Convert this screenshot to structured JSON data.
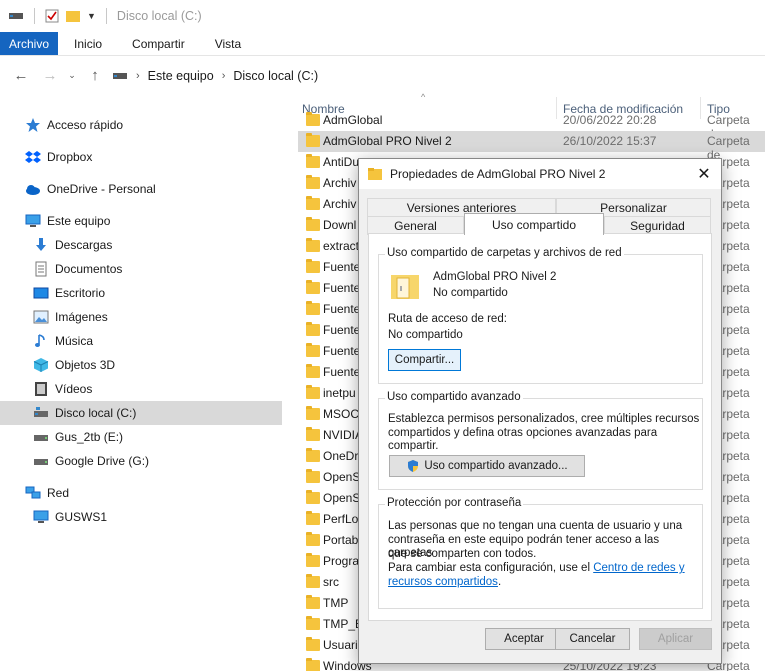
{
  "window": {
    "title": "Disco local (C:)"
  },
  "ribbon": {
    "tabs": [
      "Archivo",
      "Inicio",
      "Compartir",
      "Vista"
    ]
  },
  "address": {
    "segments": [
      "Este equipo",
      "Disco local (C:)"
    ]
  },
  "sidebar": {
    "items": [
      {
        "label": "Acceso rápido",
        "icon": "star-icon"
      },
      {
        "label": "Dropbox",
        "icon": "dropbox-icon"
      },
      {
        "label": "OneDrive - Personal",
        "icon": "cloud-icon"
      },
      {
        "label": "Este equipo",
        "icon": "computer-icon"
      },
      {
        "label": "Descargas",
        "icon": "download-icon"
      },
      {
        "label": "Documentos",
        "icon": "document-icon"
      },
      {
        "label": "Escritorio",
        "icon": "desktop-icon"
      },
      {
        "label": "Imágenes",
        "icon": "image-icon"
      },
      {
        "label": "Música",
        "icon": "music-icon"
      },
      {
        "label": "Objetos 3D",
        "icon": "cube-icon"
      },
      {
        "label": "Vídeos",
        "icon": "video-icon"
      },
      {
        "label": "Disco local (C:)",
        "icon": "drive-icon"
      },
      {
        "label": "Gus_2tb (E:)",
        "icon": "drive-icon"
      },
      {
        "label": "Google Drive (G:)",
        "icon": "drive-icon"
      },
      {
        "label": "Red",
        "icon": "network-icon"
      },
      {
        "label": "GUSWS1",
        "icon": "computer-icon"
      }
    ]
  },
  "columns": {
    "name": "Nombre",
    "date": "Fecha de modificación",
    "type": "Tipo"
  },
  "files": [
    {
      "name": "AdmGlobal",
      "date": "20/06/2022 20:28",
      "type": "Carpeta de"
    },
    {
      "name": "AdmGlobal PRO Nivel 2",
      "date": "26/10/2022 15:37",
      "type": "Carpeta de"
    },
    {
      "name": "AntiDu",
      "date": "",
      "type": "Carpeta de"
    },
    {
      "name": "Archiv",
      "date": "",
      "type": "Carpeta de"
    },
    {
      "name": "Archiv",
      "date": "",
      "type": "Carpeta de"
    },
    {
      "name": "Downl",
      "date": "",
      "type": "Carpeta de"
    },
    {
      "name": "extract",
      "date": "",
      "type": "Carpeta de"
    },
    {
      "name": "Fuente",
      "date": "",
      "type": "Carpeta de"
    },
    {
      "name": "Fuente",
      "date": "",
      "type": "Carpeta de"
    },
    {
      "name": "Fuente",
      "date": "",
      "type": "Carpeta de"
    },
    {
      "name": "Fuente",
      "date": "",
      "type": "Carpeta de"
    },
    {
      "name": "Fuente",
      "date": "",
      "type": "Carpeta de"
    },
    {
      "name": "Fuente",
      "date": "",
      "type": "Carpeta de"
    },
    {
      "name": "inetpu",
      "date": "",
      "type": "Carpeta de"
    },
    {
      "name": "MSOC",
      "date": "",
      "type": "Carpeta de"
    },
    {
      "name": "NVIDIA",
      "date": "",
      "type": "Carpeta de"
    },
    {
      "name": "OneDr",
      "date": "",
      "type": "Carpeta de"
    },
    {
      "name": "OpenS",
      "date": "",
      "type": "Carpeta de"
    },
    {
      "name": "OpenS",
      "date": "",
      "type": "Carpeta de"
    },
    {
      "name": "PerfLo",
      "date": "",
      "type": "Carpeta de"
    },
    {
      "name": "Portab",
      "date": "",
      "type": "Carpeta de"
    },
    {
      "name": "Progra",
      "date": "",
      "type": "Carpeta de"
    },
    {
      "name": "src",
      "date": "",
      "type": "Carpeta de"
    },
    {
      "name": "TMP",
      "date": "",
      "type": "Carpeta de"
    },
    {
      "name": "TMP_E",
      "date": "",
      "type": "Carpeta de"
    },
    {
      "name": "Usuari",
      "date": "",
      "type": "Carpeta de"
    },
    {
      "name": "Windows",
      "date": "25/10/2022 19:23",
      "type": "Carpeta de"
    }
  ],
  "dialog": {
    "title": "Propiedades de AdmGlobal PRO Nivel 2",
    "tabs_back": [
      "Versiones anteriores",
      "Personalizar"
    ],
    "tabs_front": [
      "General",
      "Uso compartido",
      "Seguridad"
    ],
    "network_group": {
      "label": "Uso compartido de carpetas y archivos de red",
      "folder_name": "AdmGlobal PRO Nivel 2",
      "status": "No compartido",
      "path_label": "Ruta de acceso de red:",
      "path_value": "No compartido",
      "share_button": "Compartir..."
    },
    "advanced_group": {
      "label": "Uso compartido avanzado",
      "description_line1": "Establezca permisos personalizados, cree múltiples recursos",
      "description_line2": "compartidos y defina otras opciones avanzadas para compartir.",
      "button": "Uso compartido avanzado..."
    },
    "password_group": {
      "label": "Protección por contraseña",
      "line1": "Las personas que no tengan una cuenta de usuario y una",
      "line2": "contraseña en este equipo podrán tener acceso a las carpetas",
      "line3": "que se comparten con todos.",
      "line4": "Para cambiar esta configuración, use el ",
      "link1": "Centro de redes y",
      "link2": "recursos compartidos",
      "end": "."
    },
    "buttons": {
      "ok": "Aceptar",
      "cancel": "Cancelar",
      "apply": "Aplicar"
    }
  }
}
